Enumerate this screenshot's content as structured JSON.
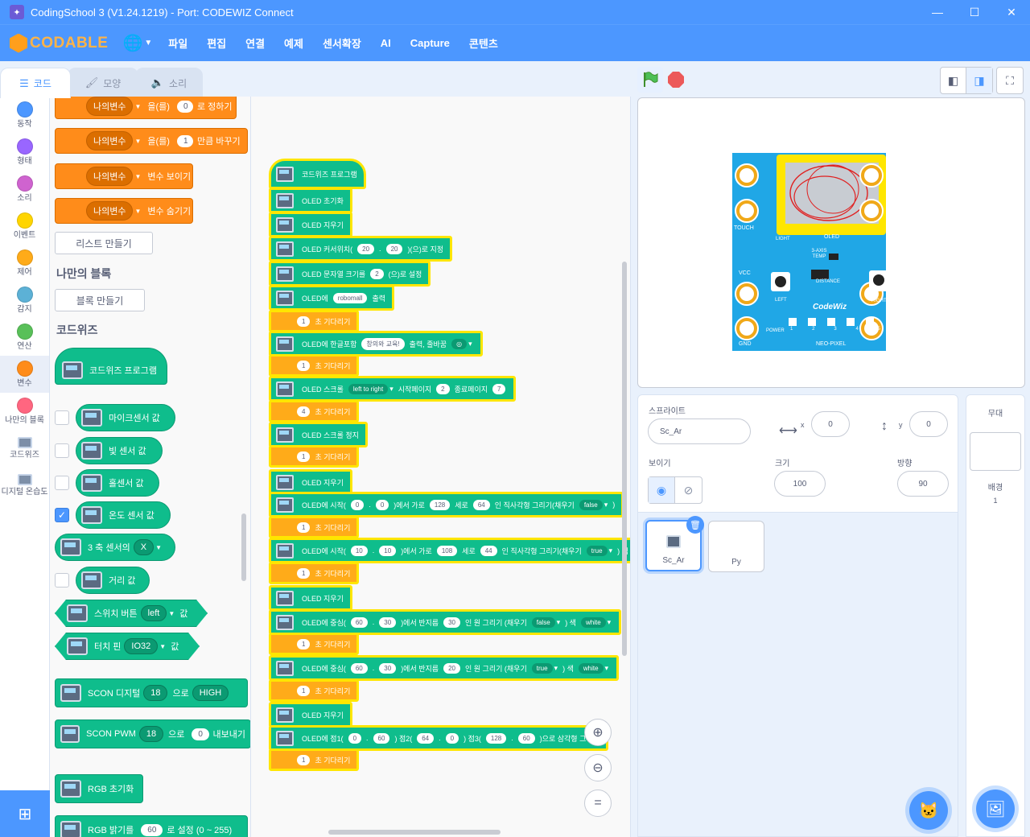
{
  "window": {
    "title": "CodingSchool 3 (V1.24.1219) - Port: CODEWIZ Connect"
  },
  "menu": {
    "logo": "CODABLE",
    "items": [
      "파일",
      "편집",
      "연결",
      "예제",
      "센서확장",
      "AI",
      "Capture",
      "콘텐츠"
    ]
  },
  "tabs": [
    "코드",
    "모양",
    "소리"
  ],
  "categories": [
    {
      "label": "동작",
      "color": "#4c97ff"
    },
    {
      "label": "형태",
      "color": "#9966ff"
    },
    {
      "label": "소리",
      "color": "#cf63cf"
    },
    {
      "label": "이벤트",
      "color": "#ffd500"
    },
    {
      "label": "제어",
      "color": "#ffab19"
    },
    {
      "label": "감지",
      "color": "#5cb1d6"
    },
    {
      "label": "연산",
      "color": "#59c059"
    },
    {
      "label": "변수",
      "color": "#ff8c1a"
    },
    {
      "label": "나만의 블록",
      "color": "#ff6680"
    },
    {
      "label": "코드위즈",
      "color": ""
    },
    {
      "label": "디지털 온습도",
      "color": ""
    }
  ],
  "palette": {
    "var_blocks": [
      {
        "var": "나의변수",
        "mid": "을(를)",
        "value": "0",
        "tail": "로 정하기"
      },
      {
        "var": "나의변수",
        "mid": "을(를)",
        "value": "1",
        "tail": "만큼 바꾸기"
      },
      {
        "var": "나의변수",
        "tail": "변수 보이기"
      },
      {
        "var": "나의변수",
        "tail": "변수 숨기기"
      }
    ],
    "make_list": "리스트 만들기",
    "my_blocks_title": "나만의 블록",
    "make_block": "블록 만들기",
    "codewiz_title": "코드위즈",
    "program_hat": "코드위즈 프로그램",
    "sensors": [
      {
        "label": "마이크센서 값",
        "checked": false
      },
      {
        "label": "빛 센서 값",
        "checked": false
      },
      {
        "label": "홀센서 값",
        "checked": false
      },
      {
        "label": "온도 센서 값",
        "checked": true
      }
    ],
    "axis": {
      "label": "3 축 센서의",
      "value": "X"
    },
    "distance": {
      "label": "거리 값",
      "checked": false
    },
    "switch": {
      "label": "스위치 버튼",
      "value": "left",
      "tail": "값"
    },
    "touch": {
      "label": "터치 핀",
      "value": "IO32",
      "tail": "값"
    },
    "scon_digital": {
      "label": "SCON 디지털",
      "pin": "18",
      "mid": "으로",
      "value": "HIGH"
    },
    "scon_pwm": {
      "label": "SCON PWM",
      "pin": "18",
      "mid": "으로",
      "value": "0",
      "tail": "내보내기"
    },
    "rgb_init": "RGB 초기화",
    "rgb_bright": {
      "label": "RGB 밝기를",
      "value": "60",
      "tail": "로 설정 (0 ~ 255)"
    }
  },
  "script": {
    "blocks": [
      {
        "t": "g",
        "parts": [
          [
            "t",
            "코드위즈 프로그램"
          ]
        ]
      },
      {
        "t": "g",
        "parts": [
          [
            "t",
            "OLED 초기화"
          ]
        ]
      },
      {
        "t": "g",
        "parts": [
          [
            "t",
            "OLED 지우기"
          ]
        ]
      },
      {
        "t": "g",
        "parts": [
          [
            "t",
            "OLED 커서위치("
          ],
          [
            "i",
            "20"
          ],
          [
            "t",
            "."
          ],
          [
            "i",
            "20"
          ],
          [
            "t",
            ")(으)로 지정"
          ]
        ]
      },
      {
        "t": "g",
        "parts": [
          [
            "t",
            "OLED 문자열 크기를"
          ],
          [
            "i",
            "2"
          ],
          [
            "t",
            "(으)로 설정"
          ]
        ]
      },
      {
        "t": "g",
        "parts": [
          [
            "t",
            "OLED에"
          ],
          [
            "i",
            "robomall"
          ],
          [
            "t",
            "출력"
          ]
        ]
      },
      {
        "t": "o",
        "parts": [
          [
            "i",
            "1"
          ],
          [
            "t",
            "초 기다리기"
          ]
        ]
      },
      {
        "t": "g",
        "parts": [
          [
            "t",
            "OLED에 한글포함"
          ],
          [
            "i",
            "창의와 교육!"
          ],
          [
            "t",
            "출력, 줄바꿈"
          ],
          [
            "d",
            "◎"
          ]
        ]
      },
      {
        "t": "o",
        "parts": [
          [
            "i",
            "1"
          ],
          [
            "t",
            "초 기다리기"
          ]
        ]
      },
      {
        "t": "g",
        "parts": [
          [
            "t",
            "OLED 스크롤"
          ],
          [
            "d",
            "left to right"
          ],
          [
            "t",
            "시작페이지"
          ],
          [
            "i",
            "2"
          ],
          [
            "t",
            "종료페이지"
          ],
          [
            "i",
            "7"
          ]
        ]
      },
      {
        "t": "o",
        "parts": [
          [
            "i",
            "4"
          ],
          [
            "t",
            "초 기다리기"
          ]
        ]
      },
      {
        "t": "g",
        "parts": [
          [
            "t",
            "OLED 스크롤 정지"
          ]
        ]
      },
      {
        "t": "o",
        "parts": [
          [
            "i",
            "1"
          ],
          [
            "t",
            "초 기다리기"
          ]
        ]
      },
      {
        "t": "g",
        "parts": [
          [
            "t",
            "OLED 지우기"
          ]
        ]
      },
      {
        "t": "g",
        "parts": [
          [
            "t",
            "OLED에 시작("
          ],
          [
            "i",
            "0"
          ],
          [
            "t",
            "."
          ],
          [
            "i",
            "0"
          ],
          [
            "t",
            ")에서 가로"
          ],
          [
            "i",
            "128"
          ],
          [
            "t",
            "세로"
          ],
          [
            "i",
            "64"
          ],
          [
            "t",
            "인 직사각형 그리기(채우기"
          ],
          [
            "d",
            "false"
          ],
          [
            "t",
            ")"
          ]
        ]
      },
      {
        "t": "o",
        "parts": [
          [
            "i",
            "1"
          ],
          [
            "t",
            "초 기다리기"
          ]
        ]
      },
      {
        "t": "g",
        "parts": [
          [
            "t",
            "OLED에 시작("
          ],
          [
            "i",
            "10"
          ],
          [
            "t",
            "."
          ],
          [
            "i",
            "10"
          ],
          [
            "t",
            ")에서 가로"
          ],
          [
            "i",
            "108"
          ],
          [
            "t",
            "세로"
          ],
          [
            "i",
            "44"
          ],
          [
            "t",
            "인 직사각형 그리기(채우기"
          ],
          [
            "d",
            "true"
          ],
          [
            "t",
            ") 색"
          ]
        ]
      },
      {
        "t": "o",
        "parts": [
          [
            "i",
            "1"
          ],
          [
            "t",
            "초 기다리기"
          ]
        ]
      },
      {
        "t": "g",
        "parts": [
          [
            "t",
            "OLED 지우기"
          ]
        ]
      },
      {
        "t": "g",
        "parts": [
          [
            "t",
            "OLED에 중심("
          ],
          [
            "i",
            "60"
          ],
          [
            "t",
            "."
          ],
          [
            "i",
            "30"
          ],
          [
            "t",
            ")에서 반지름"
          ],
          [
            "i",
            "30"
          ],
          [
            "t",
            "인 원 그리기 (채우기"
          ],
          [
            "d",
            "false"
          ],
          [
            "t",
            ") 색"
          ],
          [
            "d",
            "white"
          ]
        ]
      },
      {
        "t": "o",
        "parts": [
          [
            "i",
            "1"
          ],
          [
            "t",
            "초 기다리기"
          ]
        ]
      },
      {
        "t": "g",
        "parts": [
          [
            "t",
            "OLED에 중심("
          ],
          [
            "i",
            "60"
          ],
          [
            "t",
            "."
          ],
          [
            "i",
            "30"
          ],
          [
            "t",
            ")에서 반지름"
          ],
          [
            "i",
            "20"
          ],
          [
            "t",
            "인 원 그리기 (채우기"
          ],
          [
            "d",
            "true"
          ],
          [
            "t",
            ") 색"
          ],
          [
            "d",
            "white"
          ]
        ]
      },
      {
        "t": "o",
        "parts": [
          [
            "i",
            "1"
          ],
          [
            "t",
            "초 기다리기"
          ]
        ]
      },
      {
        "t": "g",
        "parts": [
          [
            "t",
            "OLED 지우기"
          ]
        ]
      },
      {
        "t": "g",
        "parts": [
          [
            "t",
            "OLED에 점1("
          ],
          [
            "i",
            "0"
          ],
          [
            "t",
            "."
          ],
          [
            "i",
            "60"
          ],
          [
            "t",
            ") 점2("
          ],
          [
            "i",
            "64"
          ],
          [
            "t",
            "."
          ],
          [
            "i",
            "0"
          ],
          [
            "t",
            ") 점3("
          ],
          [
            "i",
            "128"
          ],
          [
            "t",
            "."
          ],
          [
            "i",
            "60"
          ],
          [
            "t",
            ")으로 삼각형 그리기"
          ]
        ]
      },
      {
        "t": "o",
        "parts": [
          [
            "i",
            "1"
          ],
          [
            "t",
            "초 기다리기"
          ]
        ]
      }
    ]
  },
  "board": {
    "labels": [
      "TOUCH",
      "LIGHT",
      "OLED",
      "TOUCH",
      "3-AXIS TEMP",
      "MIC",
      "VCC",
      "DISTANCE",
      "TOUCH",
      "LEFT",
      "RIGHT",
      "CodeWiz",
      "POWER",
      "GND",
      "NEO-PIXEL"
    ],
    "pixel_nums": [
      "1",
      "2",
      "3",
      "4",
      "5"
    ]
  },
  "sprite": {
    "label": "스프라이트",
    "name": "Sc_Ar",
    "x_label": "x",
    "x": "0",
    "y_label": "y",
    "y": "0",
    "show_label": "보이기",
    "size_label": "크기",
    "size": "100",
    "dir_label": "방향",
    "direction": "90"
  },
  "sprites": [
    {
      "name": "Sc_Ar",
      "selected": true
    },
    {
      "name": "Py",
      "selected": false
    }
  ],
  "stage": {
    "title": "무대",
    "bg_label": "배경",
    "bg_count": "1"
  },
  "colors": {
    "accent": "#4c97ff",
    "block_green": "#0fbd8c",
    "block_orange": "#ff8c1a",
    "control": "#ffab19",
    "highlight": "#ffe600",
    "board": "#20a7e6"
  }
}
